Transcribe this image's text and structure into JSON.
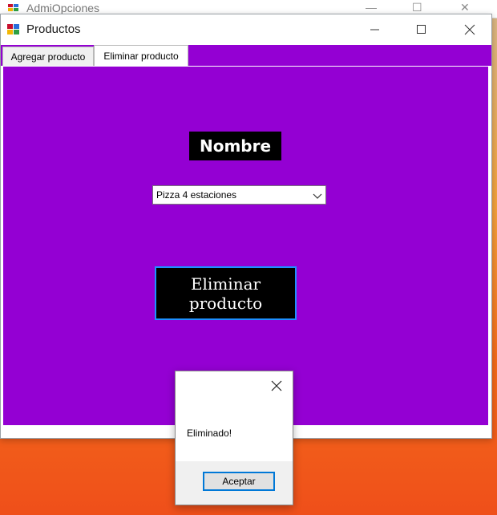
{
  "background_window": {
    "title": "AdmiOpciones"
  },
  "window": {
    "title": "Productos",
    "controls": {
      "minimize": "minimize",
      "maximize": "maximize",
      "close": "close"
    }
  },
  "tabs": [
    {
      "label": "Agregar producto",
      "active": false
    },
    {
      "label": "Eliminar producto",
      "active": true
    }
  ],
  "form": {
    "nombre_label": "Nombre",
    "product_select": {
      "selected": "Pizza 4 estaciones"
    },
    "delete_button": "Eliminar producto"
  },
  "dialog": {
    "message": "Eliminado!",
    "ok_label": "Aceptar"
  },
  "colors": {
    "form_background": "#9400d3",
    "button_background": "#000000",
    "button_border": "#1e90ff"
  }
}
